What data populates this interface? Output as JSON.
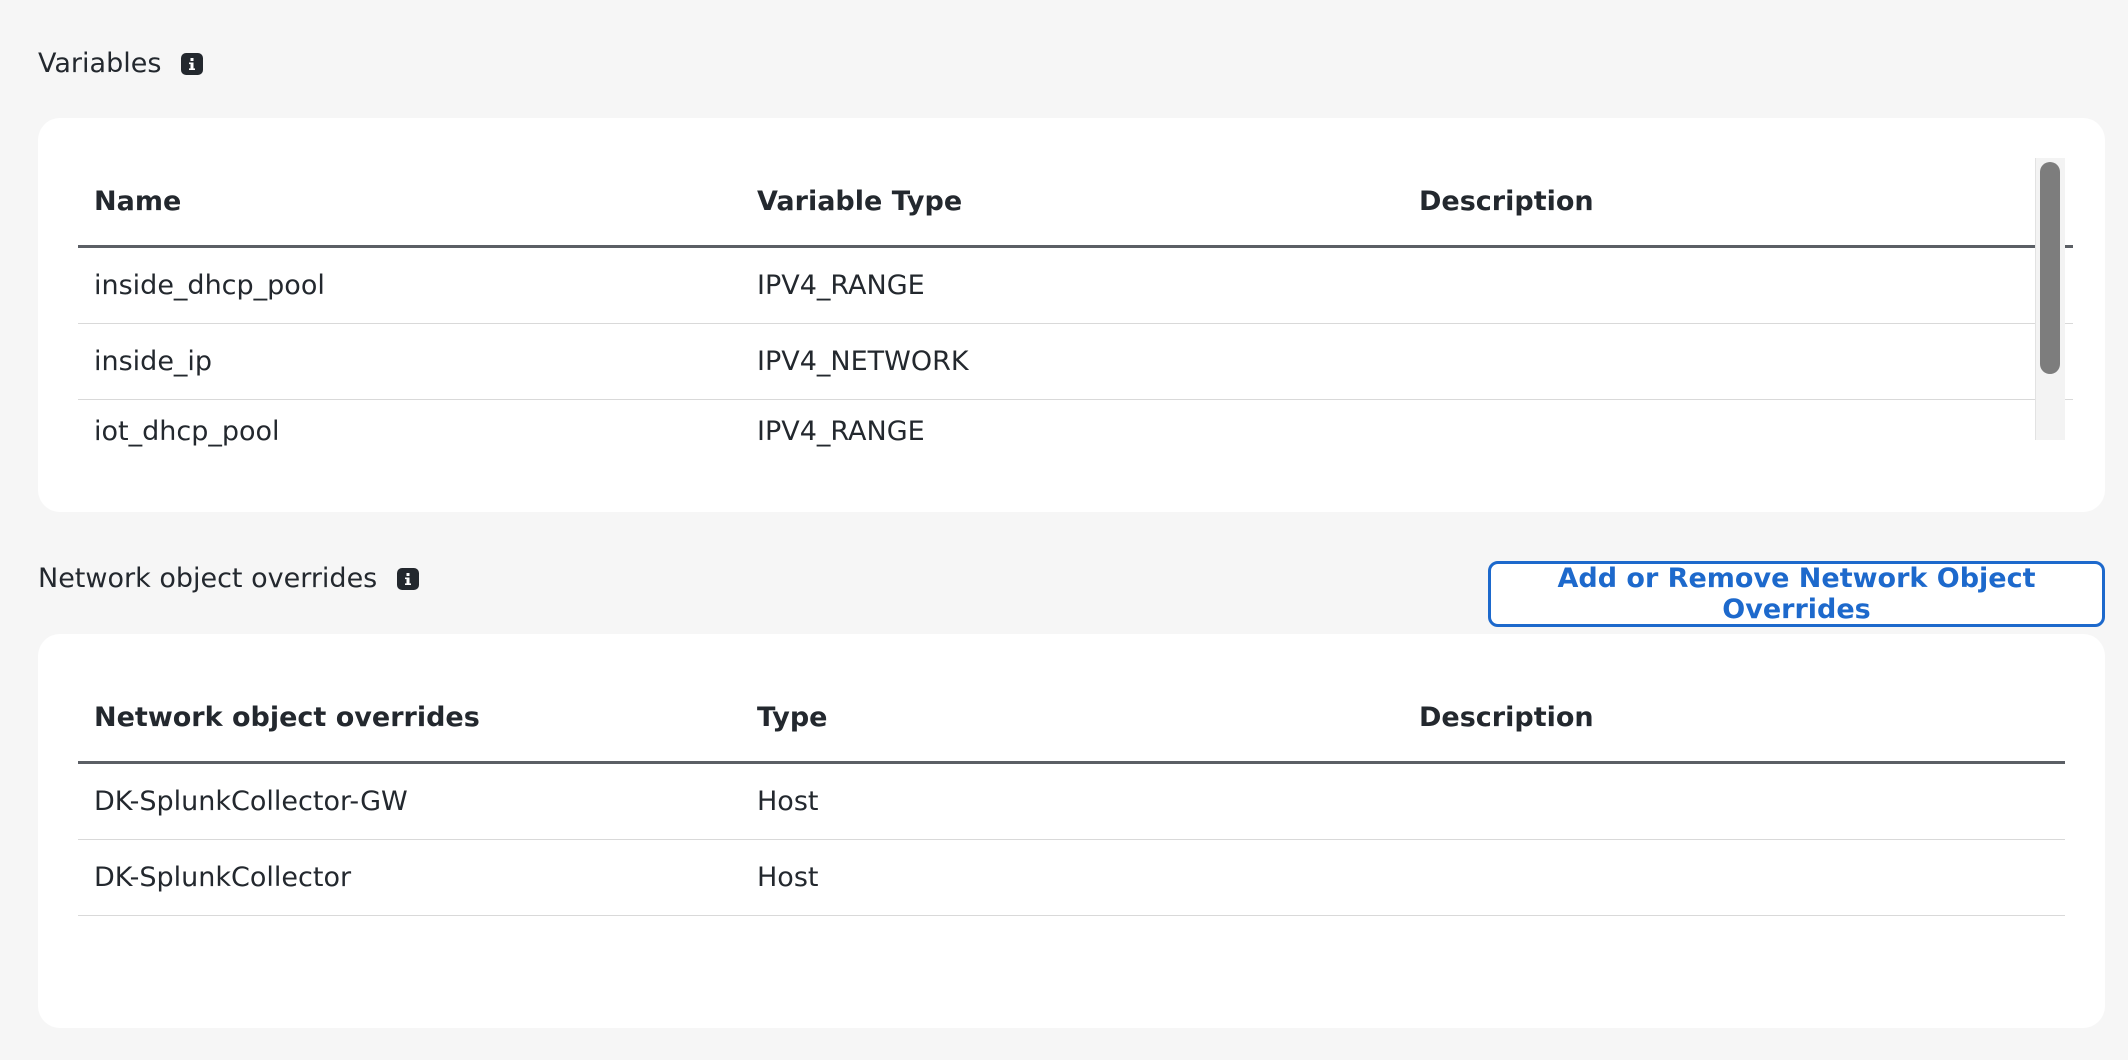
{
  "variables": {
    "title": "Variables",
    "columns": [
      "Name",
      "Variable Type",
      "Description"
    ],
    "rows": [
      {
        "name": "inside_dhcp_pool",
        "type": "IPV4_RANGE",
        "description": ""
      },
      {
        "name": "inside_ip",
        "type": "IPV4_NETWORK",
        "description": ""
      },
      {
        "name": "iot_dhcp_pool",
        "type": "IPV4_RANGE",
        "description": ""
      }
    ]
  },
  "overrides": {
    "title": "Network object overrides",
    "button_label": "Add or Remove Network Object Overrides",
    "columns": [
      "Network object overrides",
      "Type",
      "Description"
    ],
    "rows": [
      {
        "name": "DK-SplunkCollector-GW",
        "type": "Host",
        "description": ""
      },
      {
        "name": "DK-SplunkCollector",
        "type": "Host",
        "description": ""
      }
    ]
  },
  "icons": {
    "info": "info-icon"
  },
  "colors": {
    "accent": "#1d69cc",
    "text": "#23282e",
    "background": "#f6f6f6"
  }
}
